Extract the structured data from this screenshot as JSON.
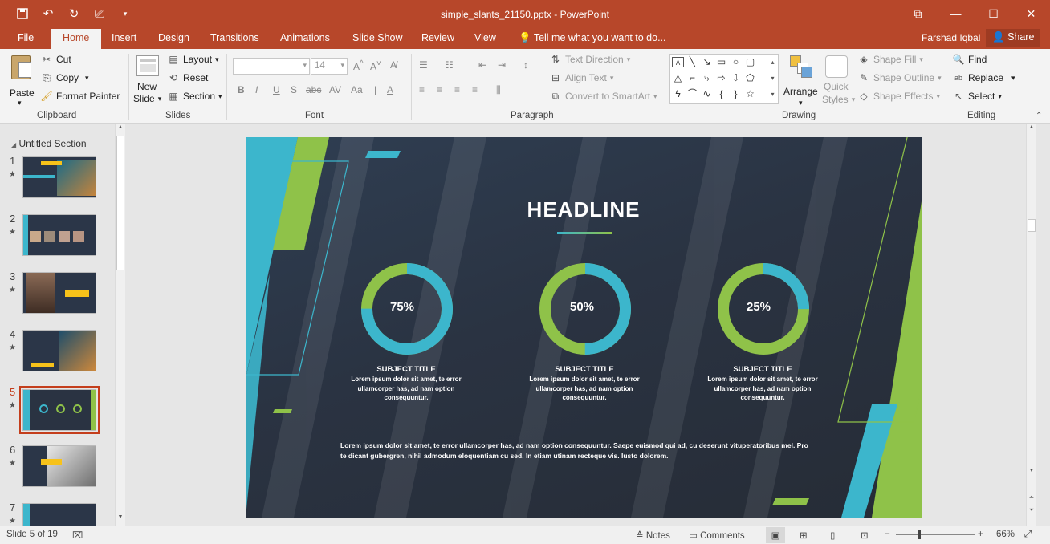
{
  "window": {
    "title": "simple_slants_21150.pptx - PowerPoint",
    "qat_icons": [
      "save-icon",
      "undo-icon",
      "redo-icon",
      "presenter-icon",
      "customize-qat-icon"
    ],
    "controls": [
      "ribbon-display-options-icon",
      "minimize-icon",
      "maximize-icon",
      "close-icon"
    ]
  },
  "ribbon_tabs": {
    "file": "File",
    "home": "Home",
    "insert": "Insert",
    "design": "Design",
    "transitions": "Transitions",
    "animations": "Animations",
    "slideshow": "Slide Show",
    "review": "Review",
    "view": "View",
    "tellme": "Tell me what you want to do...",
    "user": "Farshad Iqbal",
    "share": "Share"
  },
  "ribbon": {
    "clipboard": {
      "paste": "Paste",
      "cut": "Cut",
      "copy": "Copy",
      "format_painter": "Format Painter",
      "label": "Clipboard"
    },
    "slides": {
      "new_slide_1": "New",
      "new_slide_2": "Slide",
      "layout": "Layout",
      "reset": "Reset",
      "section": "Section",
      "label": "Slides"
    },
    "font": {
      "font_name": "",
      "font_size": "14",
      "label": "Font"
    },
    "paragraph": {
      "text_direction": "Text Direction",
      "align_text": "Align Text",
      "convert_smartart": "Convert to SmartArt",
      "label": "Paragraph"
    },
    "drawing": {
      "arrange": "Arrange",
      "quick_styles_1": "Quick",
      "quick_styles_2": "Styles",
      "shape_fill": "Shape Fill",
      "shape_outline": "Shape Outline",
      "shape_effects": "Shape Effects",
      "label": "Drawing"
    },
    "editing": {
      "find": "Find",
      "replace": "Replace",
      "select": "Select",
      "label": "Editing"
    }
  },
  "thumbnails": {
    "section_title": "Untitled Section",
    "items": [
      {
        "number": "1"
      },
      {
        "number": "2"
      },
      {
        "number": "3"
      },
      {
        "number": "4"
      },
      {
        "number": "5",
        "selected": true
      },
      {
        "number": "6"
      },
      {
        "number": "7"
      }
    ]
  },
  "slide": {
    "headline": "HEADLINE",
    "donuts": [
      {
        "percent_label": "75%",
        "value": 0.75,
        "title": "SUBJECT TITLE",
        "text": "Lorem ipsum dolor sit amet, te error ullamcorper has, ad nam option consequuntur."
      },
      {
        "percent_label": "50%",
        "value": 0.5,
        "title": "SUBJECT TITLE",
        "text": "Lorem ipsum dolor sit amet, te error ullamcorper has, ad nam option consequuntur."
      },
      {
        "percent_label": "25%",
        "value": 0.25,
        "title": "SUBJECT TITLE",
        "text": "Lorem ipsum dolor sit amet, te error ullamcorper has, ad nam option consequuntur."
      }
    ],
    "body": "Lorem ipsum dolor sit amet, te error ullamcorper has, ad nam option consequuntur. Saepe euismod qui ad, cu deserunt vituperatoribus mel. Pro te dicant gubergren, nihil admodum eloquentiam cu sed. In etiam utinam recteque vis. Iusto dolorem.",
    "colors": {
      "cyan": "#3cb6cc",
      "green": "#8fc249",
      "background": "#2a3342"
    }
  },
  "statusbar": {
    "slide_info": "Slide 5 of 19",
    "notes": "Notes",
    "comments": "Comments",
    "zoom": "66%"
  }
}
